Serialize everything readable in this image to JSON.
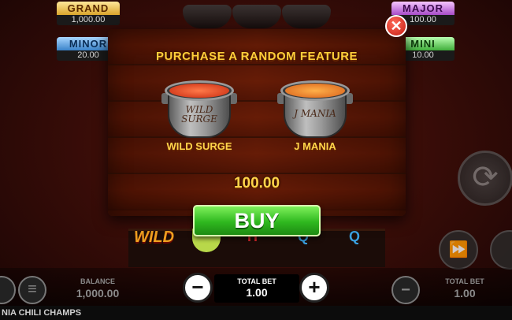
{
  "jackpots": {
    "grand": {
      "name": "GRAND",
      "value": "1,000.00"
    },
    "major": {
      "name": "MAJOR",
      "value": "100.00"
    },
    "minor": {
      "name": "MINOR",
      "value": "20.00"
    },
    "mini": {
      "name": "MINI",
      "value": "10.00"
    }
  },
  "dialog": {
    "title": "PURCHASE A RANDOM FEATURE",
    "close_icon": "close-x-icon",
    "features": [
      {
        "label": "WILD SURGE",
        "pot_text": "WILD SURGE",
        "food_color": "#e0431f"
      },
      {
        "label": "J MANIA",
        "pot_text": "J MANIA",
        "food_color": "#f08a22"
      }
    ],
    "price": "100.00",
    "buy_label": "BUY"
  },
  "reels": {
    "symbols": [
      "WILD",
      "H",
      "Q",
      "Q"
    ]
  },
  "controls": {
    "balance_label": "BALANCE",
    "balance_value": "1,000.00",
    "total_bet_label": "TOTAL BET",
    "total_bet_value": "1.00",
    "minus": "−",
    "plus": "+",
    "right_total_bet_label": "TOTAL BET",
    "right_total_bet_value": "1.00"
  },
  "game_name": "NIA CHILI CHAMPS",
  "colors": {
    "accent_gold": "#ffd44a",
    "buy_green": "#2fb81f",
    "close_red": "#c41b10"
  }
}
